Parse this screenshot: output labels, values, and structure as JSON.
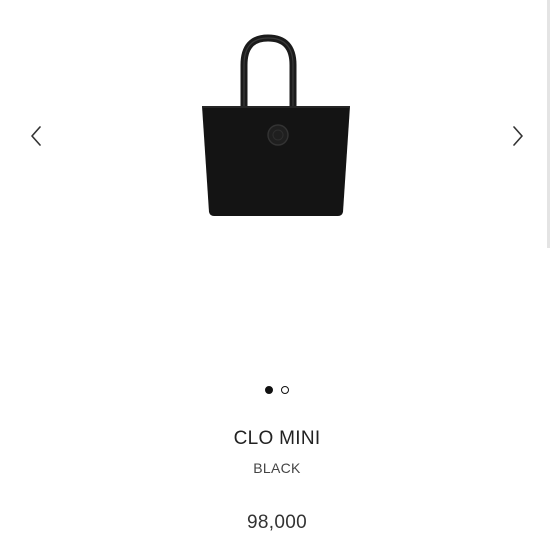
{
  "carousel": {
    "prev_icon": "chevron-left-icon",
    "next_icon": "chevron-right-icon",
    "image": "black-tote-bag",
    "total_slides": 2,
    "active_slide": 1
  },
  "product": {
    "name": "CLO MINI",
    "color": "BLACK",
    "price": "98,000"
  }
}
